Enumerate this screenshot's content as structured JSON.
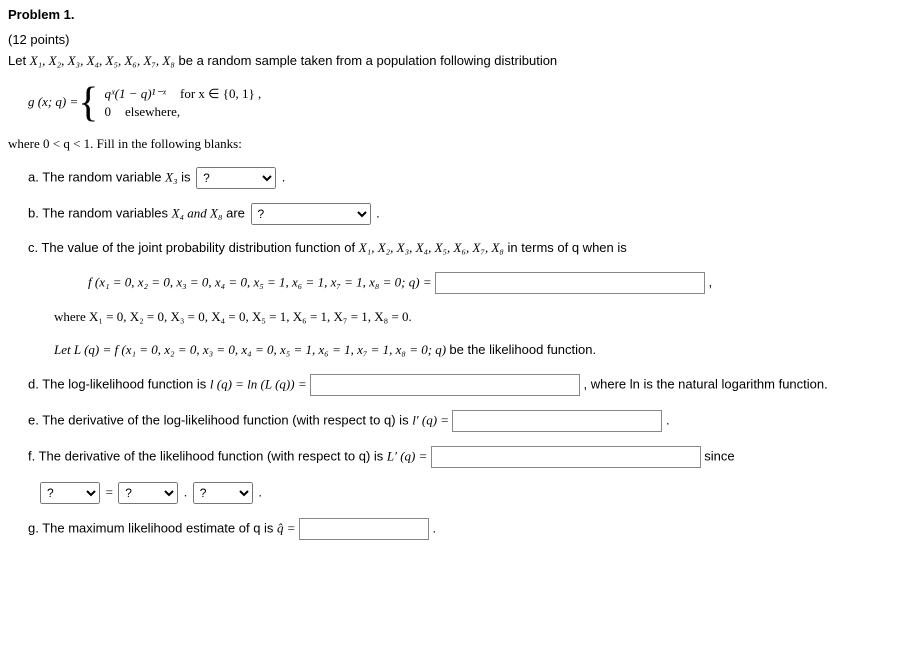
{
  "title": "Problem 1.",
  "points": "(12 points)",
  "intro_prefix": "Let ",
  "sample_vars": "X₁, X₂, X₃, X₄, X₅, X₆, X₇, X₈",
  "intro_suffix": " be a random sample taken from a population following distribution",
  "pmf": {
    "lhs": "g (x; q) = ",
    "case1_expr": "qˣ(1 − q)¹⁻ˣ",
    "case1_cond": "for x ∈ {0, 1} ,",
    "case2_expr": "0",
    "case2_cond": "elsewhere,"
  },
  "where_q": "where 0 < q < 1. Fill in the following blanks:",
  "a": {
    "label": "a. The random variable ",
    "var": "X₃",
    "after": " is",
    "placeholder": "?"
  },
  "b": {
    "label": "b. The random variables ",
    "vars": "X₄ and X₈",
    "after": " are",
    "placeholder": "?"
  },
  "c": {
    "label": "c. The value of the joint probability distribution function of ",
    "vars": "X₁, X₂, X₃, X₄, X₅, X₆, X₇, X₈",
    "after": " in terms of q when is",
    "f_expr": "f (x₁ = 0, x₂ = 0, x₃ = 0, x₄ = 0, x₅ = 1, x₆ = 1, x₇ = 1, x₈ = 0; q) = ",
    "where_line": "where X₁ = 0, X₂ = 0, X₃ = 0, X₄ = 0, X₅ = 1, X₆ = 1, X₇ = 1, X₈ = 0.",
    "let_line_pre": "Let L (q) = f (x₁ = 0, x₂ = 0, x₃ = 0, x₄ = 0, x₅ = 1, x₆ = 1, x₇ = 1, x₈ = 0; q) ",
    "let_line_post": "be the likelihood function."
  },
  "d": {
    "prefix": "d. The log-likelihood function is ",
    "expr": "l (q) = ln (L (q)) = ",
    "suffix": ", where ln is the natural logarithm function."
  },
  "e": {
    "prefix": "e. The derivative of the log-likelihood function (with respect to q) is ",
    "expr": "l′ (q) = ",
    "suffix": "."
  },
  "f": {
    "prefix": "f. The derivative of the likelihood function (with respect to q) is ",
    "expr": "L′ (q) = ",
    "since": "since",
    "eq": " = ",
    "dot": ".",
    "placeholder": "?"
  },
  "g": {
    "prefix": "g. The maximum likelihood estimate of q is ",
    "expr": "q̂ = ",
    "suffix": "."
  }
}
